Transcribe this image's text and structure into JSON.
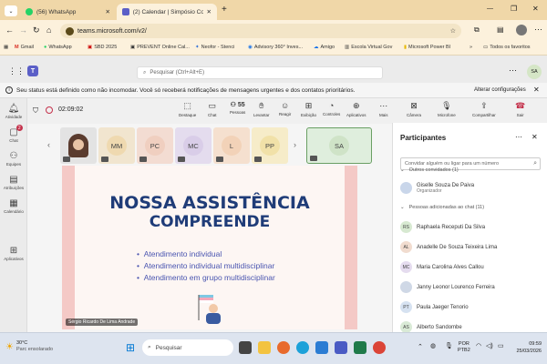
{
  "browser": {
    "tabs": [
      {
        "title": "(56) WhatsApp"
      },
      {
        "title": "(2) Calendar | Simpósio Con"
      }
    ],
    "new_tab": "+",
    "url": "teams.microsoft.com/v2/",
    "bookmarks": [
      "Gmail",
      "WhatsApp",
      "SBD 2025",
      "PREVENT Online Cal...",
      "Neofor - Stenci",
      "Advisory 360° Inves...",
      "Amigo",
      "Escola Virtual Gov",
      "Microsoft Power BI"
    ],
    "all_favorites": "Todos os favoritos",
    "profile_initials": "SA"
  },
  "teams": {
    "search_placeholder": "Pesquisar (Ctrl+Alt+E)",
    "profile": "SA",
    "banner_text": "Seu status está definido como não incomodar. Você só receberá notificações de mensagens urgentes e dos contatos prioritários.",
    "banner_action": "Alterar configurações",
    "rail": [
      {
        "label": "Atividade"
      },
      {
        "label": "Chat",
        "badge": "2"
      },
      {
        "label": "Equipes"
      },
      {
        "label": "Atribuições"
      },
      {
        "label": "Calendário"
      },
      {
        "label": "Aplicativos"
      }
    ],
    "meeting": {
      "timer": "02:09:02",
      "toolbar": [
        {
          "label": "Destaque"
        },
        {
          "label": "Chat"
        },
        {
          "label": "Pessoas",
          "count": "55"
        },
        {
          "label": "Levantar"
        },
        {
          "label": "Reagir"
        },
        {
          "label": "Exibição"
        },
        {
          "label": "Controles"
        },
        {
          "label": "Aplicativos"
        },
        {
          "label": "Mais"
        },
        {
          "label": "Câmera"
        },
        {
          "label": "Microfone"
        },
        {
          "label": "Compartilhar"
        },
        {
          "label": "Sair"
        }
      ],
      "tiles": [
        "MM",
        "PC",
        "MC",
        "L",
        "PP"
      ],
      "self_tile": "SA",
      "presenter_name": "Sérgio Ricardo De Lima Andrade",
      "slide": {
        "title_line1": "NOSSA ASSISTÊNCIA",
        "title_line2": "COMPREENDE",
        "bullets": [
          "Atendimento individual",
          "Atendimento individual multidisciplinar",
          "Atendimento em grupo multidisciplinar"
        ]
      }
    },
    "participants": {
      "title": "Participantes",
      "invite_placeholder": "Convidar alguém ou ligar para um número",
      "section_other": "Outros convidados (1)",
      "organizer": {
        "name": "Giselle Souza De Paiva",
        "role": "Organizador"
      },
      "section_chat": "Pessoas adicionadas ao chat (11)",
      "people": [
        {
          "initials": "RS",
          "name": "Raphaela Receputi Da Silva",
          "color": "#d7e9d1"
        },
        {
          "initials": "AL",
          "name": "Anadelle De Souza Teixeira Lima",
          "color": "#f1dccf"
        },
        {
          "initials": "MC",
          "name": "Maria Carolina Alves Callou",
          "color": "#e5dcef"
        },
        {
          "initials": "",
          "name": "Janny Leonor Lourenco Ferreira",
          "color": "#cfd8e6"
        },
        {
          "initials": "PT",
          "name": "Paula Jaeger Tenorio",
          "color": "#d6e2f1"
        },
        {
          "initials": "AS",
          "name": "Alberto Sandombe",
          "color": "#d9ead6"
        }
      ]
    }
  },
  "taskbar": {
    "weather_temp": "30°C",
    "weather_desc": "Parc ensolarado",
    "search": "Pesquisar",
    "lang1": "POR",
    "lang2": "PTB2",
    "time": "09:59",
    "date": "25/03/2026"
  },
  "colors": {
    "accent": "#5b5fc7",
    "slide_title": "#1f3c78",
    "slide_bullet": "#4a55b0",
    "busy": "#c4314b"
  }
}
